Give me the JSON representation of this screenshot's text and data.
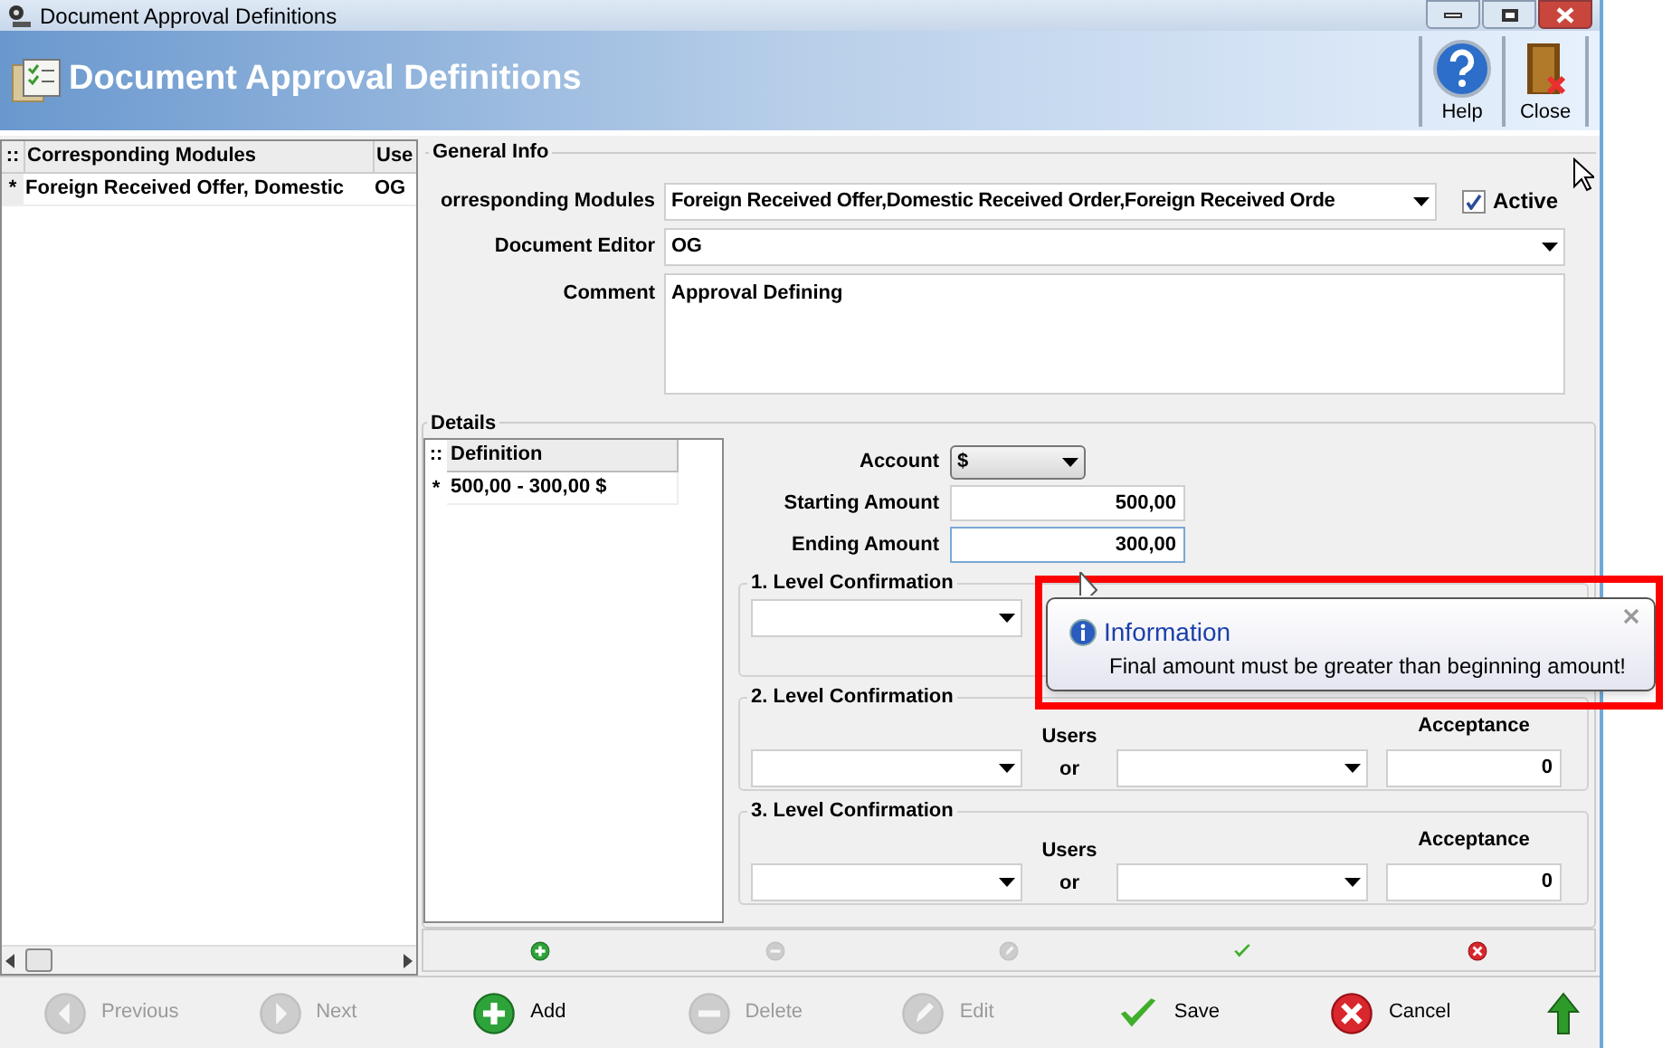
{
  "window": {
    "title": "Document Approval Definitions"
  },
  "header": {
    "title": "Document Approval Definitions",
    "buttons": [
      {
        "label": "Help",
        "kind": "help"
      },
      {
        "label": "Close",
        "kind": "close"
      }
    ]
  },
  "left_grid": {
    "corner": "::",
    "columns": [
      "Corresponding Modules",
      "Use"
    ],
    "rows": [
      {
        "marker": "*",
        "cells": [
          "Foreign Received Offer, Domestic",
          "OG"
        ]
      }
    ]
  },
  "general_info": {
    "title": "General Info",
    "modules_label": "orresponding Modules",
    "modules_value": "Foreign Received Offer,Domestic Received Order,Foreign Received Orde",
    "active": {
      "label": "Active",
      "checked": true
    },
    "editor_label": "Document Editor",
    "editor_value": "OG",
    "comment_label": "Comment",
    "comment_value": "Approval Defining"
  },
  "details": {
    "title": "Details",
    "grid": {
      "corner": "::",
      "column": "Definition",
      "rows": [
        {
          "marker": "*",
          "value": "500,00 - 300,00 $"
        }
      ]
    },
    "account_label": "Account",
    "account_value": "$",
    "starting_label": "Starting Amount",
    "starting_value": "500,00",
    "ending_label": "Ending Amount",
    "ending_value": "300,00",
    "levels": [
      {
        "title": "1. Level Confirmation"
      },
      {
        "title": "2. Level Confirmation",
        "users_label": "Users",
        "or_label": "or",
        "acceptance_label": "Acceptance",
        "acceptance_value": "0"
      },
      {
        "title": "3. Level Confirmation",
        "users_label": "Users",
        "or_label": "or",
        "acceptance_label": "Acceptance",
        "acceptance_value": "0"
      }
    ],
    "strip": [
      {
        "kind": "add"
      },
      {
        "kind": "remove"
      },
      {
        "kind": "edit"
      },
      {
        "kind": "confirm"
      },
      {
        "kind": "cancel"
      }
    ]
  },
  "tooltip": {
    "title": "Information",
    "message": "Final amount must be greater than beginning amount!"
  },
  "toolbar": [
    {
      "label": "Previous",
      "kind": "previous",
      "disabled": true
    },
    {
      "label": "Next",
      "kind": "next",
      "disabled": true
    },
    {
      "label": "Add",
      "kind": "add",
      "disabled": false
    },
    {
      "label": "Delete",
      "kind": "delete",
      "disabled": true
    },
    {
      "label": "Edit",
      "kind": "edit",
      "disabled": true
    },
    {
      "label": "Save",
      "kind": "save",
      "disabled": false
    },
    {
      "label": "Cancel",
      "kind": "cancel",
      "disabled": false
    },
    {
      "kind": "up"
    }
  ]
}
